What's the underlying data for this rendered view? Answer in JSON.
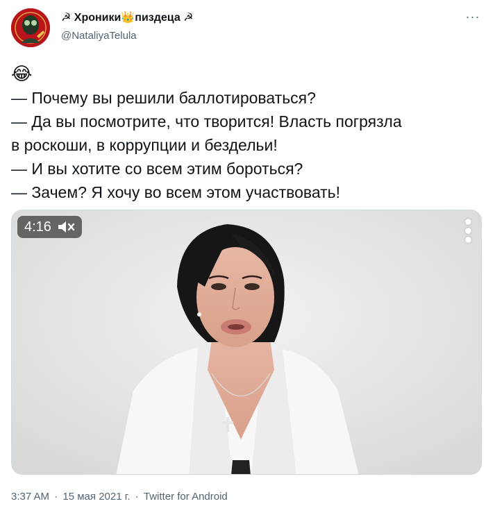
{
  "author": {
    "display_name": "☭ Хроники👑пиздеца ☭",
    "handle": "@NataliyaTelula",
    "avatar_color": "#b8141a"
  },
  "header": {
    "more_icon": "more-horizontal-icon",
    "more_label": "···"
  },
  "tweet": {
    "emoji": "😂",
    "lines": [
      "— Почему вы решили баллотироваться?",
      "— Да вы посмотрите, что творится! Власть погрязла",
      "в роскоши, в коррупции и бездельи!",
      "— И вы хотите со всем этим бороться?",
      "— Зачем? Я хочу во всем этом участвовать!"
    ]
  },
  "media": {
    "type": "video",
    "duration": "4:16",
    "mute_icon": "muted-speaker-icon",
    "menu_icon": "more-vertical-icon"
  },
  "meta": {
    "time": "3:37 AM",
    "separator": "·",
    "date": "15 мая 2021 г.",
    "source": "Twitter for Android"
  },
  "colors": {
    "text_primary": "#0f1419",
    "text_secondary": "#536471"
  }
}
